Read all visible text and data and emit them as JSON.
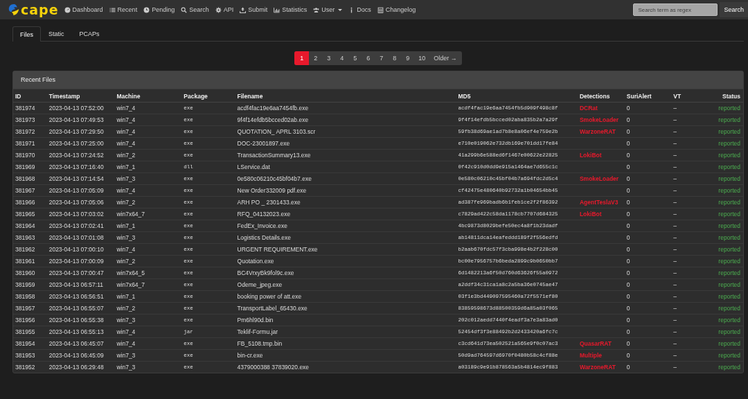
{
  "navbar": {
    "logo": "cape",
    "items": [
      {
        "label": "Dashboard"
      },
      {
        "label": "Recent"
      },
      {
        "label": "Pending"
      },
      {
        "label": "Search"
      },
      {
        "label": "API"
      },
      {
        "label": "Submit"
      },
      {
        "label": "Statistics"
      },
      {
        "label": "User",
        "dropdown": true
      },
      {
        "label": "Docs"
      },
      {
        "label": "Changelog"
      }
    ],
    "search": {
      "placeholder": "Search term as regex",
      "button": "Search"
    }
  },
  "tabs": [
    {
      "label": "Files",
      "selected": true
    },
    {
      "label": "Static",
      "selected": false
    },
    {
      "label": "PCAPs",
      "selected": false
    }
  ],
  "pagination": {
    "pages": [
      {
        "label": "1",
        "selected": true
      },
      {
        "label": "2",
        "selected": false
      },
      {
        "label": "3",
        "selected": false
      },
      {
        "label": "4",
        "selected": false
      },
      {
        "label": "5",
        "selected": false
      },
      {
        "label": "6",
        "selected": false
      },
      {
        "label": "7",
        "selected": false
      },
      {
        "label": "8",
        "selected": false
      },
      {
        "label": "9",
        "selected": false
      },
      {
        "label": "10",
        "selected": false
      }
    ],
    "next": "Older →"
  },
  "panel": {
    "title": "Recent Files",
    "columns": [
      "ID",
      "Timestamp",
      "Machine",
      "Package",
      "Filename",
      "MD5",
      "Detections",
      "SuriAlert",
      "VT",
      "Status"
    ],
    "rows": [
      {
        "id": "381974",
        "timestamp": "2023-04-13 07:52:00",
        "machine": "win7_4",
        "package": "exe",
        "filename": "acdf4fac19e6aa7454fb.exe",
        "md5": "acdf4fac19e6aa7454fb5d909f498c8f",
        "detections": "DCRat",
        "surialert": "0",
        "vt": "–",
        "status": "reported"
      },
      {
        "id": "381973",
        "timestamp": "2023-04-13 07:49:53",
        "machine": "win7_4",
        "package": "exe",
        "filename": "9f4f14efdb5bcced02ab.exe",
        "md5": "9f4f14efdb5bcced02aba835b2a7a29f",
        "detections": "SmokeLoader",
        "surialert": "0",
        "vt": "–",
        "status": "reported"
      },
      {
        "id": "381972",
        "timestamp": "2023-04-13 07:29:50",
        "machine": "win7_4",
        "package": "exe",
        "filename": "QUOTATION_ APRL 3103.scr",
        "md5": "59fb38d69ae1ad7b8e8a06ef4e759e2b",
        "detections": "WarzoneRAT",
        "surialert": "0",
        "vt": "–",
        "status": "reported"
      },
      {
        "id": "381971",
        "timestamp": "2023-04-13 07:25:00",
        "machine": "win7_4",
        "package": "exe",
        "filename": "DOC-23001897.exe",
        "md5": "e710e019062e732db169e701dd17fe84",
        "surialert": "0",
        "vt": "–",
        "status": "reported"
      },
      {
        "id": "381970",
        "timestamp": "2023-04-13 07:24:52",
        "machine": "win7_2",
        "package": "exe",
        "filename": "TransactionSummary13.exe",
        "md5": "41a299b6e588ed6f1467e00622e22825",
        "detections": "LokiBot",
        "surialert": "0",
        "vt": "–",
        "status": "reported"
      },
      {
        "id": "381969",
        "timestamp": "2023-04-13 07:16:40",
        "machine": "win7_1",
        "package": "dll",
        "filename": "LService.dat",
        "md5": "0f42c910d0dd9e915a1464ae7d655c1c",
        "surialert": "0",
        "vt": "–",
        "status": "reported"
      },
      {
        "id": "381968",
        "timestamp": "2023-04-13 07:14:54",
        "machine": "win7_3",
        "package": "exe",
        "filename": "0e580c06210c45bf04b7.exe",
        "md5": "0e580c06210c45bf04b7a694fdc2d5c4",
        "detections": "SmokeLoader",
        "surialert": "0",
        "vt": "–",
        "status": "reported"
      },
      {
        "id": "381967",
        "timestamp": "2023-04-13 07:05:09",
        "machine": "win7_4",
        "package": "exe",
        "filename": "New Order332009 pdf.exe",
        "md5": "cf42475e480640b92732a1b04654bb45",
        "surialert": "0",
        "vt": "–",
        "status": "reported"
      },
      {
        "id": "381966",
        "timestamp": "2023-04-13 07:05:06",
        "machine": "win7_2",
        "package": "exe",
        "filename": "ARH PO _ 2301433.exe",
        "md5": "ad387fe969badb6b1feb1ce2f2f86392",
        "detections": "AgentTeslaV3",
        "surialert": "0",
        "vt": "–",
        "status": "reported"
      },
      {
        "id": "381965",
        "timestamp": "2023-04-13 07:03:02",
        "machine": "win7x64_7",
        "package": "exe",
        "filename": "RFQ_04132023.exe",
        "md5": "c7829ad422c58da1178cb7707d684325",
        "detections": "LokiBot",
        "surialert": "0",
        "vt": "–",
        "status": "reported"
      },
      {
        "id": "381964",
        "timestamp": "2023-04-13 07:02:41",
        "machine": "win7_1",
        "package": "exe",
        "filename": "FedEx_Invoice.exe",
        "md5": "4bc9873d8029befe50ec4a8f1b23dadf",
        "surialert": "0",
        "vt": "–",
        "status": "reported"
      },
      {
        "id": "381963",
        "timestamp": "2023-04-13 07:01:08",
        "machine": "win7_3",
        "package": "exe",
        "filename": "Logistics Details.exe",
        "md5": "ab14811dca14eafeddd189f2f556edfd",
        "surialert": "0",
        "vt": "–",
        "status": "reported"
      },
      {
        "id": "381962",
        "timestamp": "2023-04-13 07:00:10",
        "machine": "win7_4",
        "package": "exe",
        "filename": "URGENT REQUIREMENT.exe",
        "md5": "b2aab670fdc57f3cba998e4b2f228c00",
        "surialert": "0",
        "vt": "–",
        "status": "reported"
      },
      {
        "id": "381961",
        "timestamp": "2023-04-13 07:00:09",
        "machine": "win7_2",
        "package": "exe",
        "filename": "Quotation.exe",
        "md5": "bc00e7956757b6beda2899c9b0650bb7",
        "surialert": "0",
        "vt": "–",
        "status": "reported"
      },
      {
        "id": "381960",
        "timestamp": "2023-04-13 07:00:47",
        "machine": "win7x64_5",
        "package": "exe",
        "filename": "BC4VrxyBk9fol9c.exe",
        "md5": "6d1482213a6f50d760d63626f55a0972",
        "surialert": "0",
        "vt": "–",
        "status": "reported"
      },
      {
        "id": "381959",
        "timestamp": "2023-04-13 06:57:11",
        "machine": "win7x64_7",
        "package": "exe",
        "filename": "Odeme_jpeg.exe",
        "md5": "a2ddf34c31ca1a8c2a5ba36e0745ae47",
        "surialert": "0",
        "vt": "–",
        "status": "reported"
      },
      {
        "id": "381958",
        "timestamp": "2023-04-13 06:56:51",
        "machine": "win7_1",
        "package": "exe",
        "filename": "booking power of att.exe",
        "md5": "03f1e3bd449097595460a72f5571ef80",
        "surialert": "0",
        "vt": "–",
        "status": "reported"
      },
      {
        "id": "381957",
        "timestamp": "2023-04-13 06:55:07",
        "machine": "win7_2",
        "package": "exe",
        "filename": "TransportLabel_65430.exe",
        "md5": "83859598673d88500359d6a85a03f065",
        "surialert": "0",
        "vt": "–",
        "status": "reported"
      },
      {
        "id": "381956",
        "timestamp": "2023-04-13 06:55:38",
        "machine": "win7_3",
        "package": "exe",
        "filename": "Pm6hl90d.bin",
        "md5": "202c012aedd7440f4eadf3a7e3a83ad0",
        "surialert": "0",
        "vt": "–",
        "status": "reported"
      },
      {
        "id": "381955",
        "timestamp": "2023-04-13 06:55:13",
        "machine": "win7_4",
        "package": "jar",
        "filename": "Teklif-Formu.jar",
        "md5": "52454df3f3e88492b2d2433420a6fc7c",
        "surialert": "0",
        "vt": "–",
        "status": "reported"
      },
      {
        "id": "381954",
        "timestamp": "2023-04-13 06:45:07",
        "machine": "win7_4",
        "package": "exe",
        "filename": "FB_5108.tmp.bin",
        "md5": "c3cd641d73ea502521a565e9f0c07ac3",
        "detections": "QuasarRAT",
        "surialert": "0",
        "vt": "–",
        "status": "reported"
      },
      {
        "id": "381953",
        "timestamp": "2023-04-13 06:45:09",
        "machine": "win7_3",
        "package": "exe",
        "filename": "bin-cr.exe",
        "md5": "50d9ad764597d6970f0480b58c4cf88e",
        "detections": "Multiple",
        "surialert": "0",
        "vt": "–",
        "status": "reported"
      },
      {
        "id": "381952",
        "timestamp": "2023-04-13 06:29:48",
        "machine": "win7_3",
        "package": "exe",
        "filename": "4379000388 37839020.exe",
        "md5": "a03189c9e91b878563a5b4814ec9f883",
        "detections": "WarzoneRAT",
        "surialert": "0",
        "vt": "–",
        "status": "reported"
      }
    ]
  }
}
